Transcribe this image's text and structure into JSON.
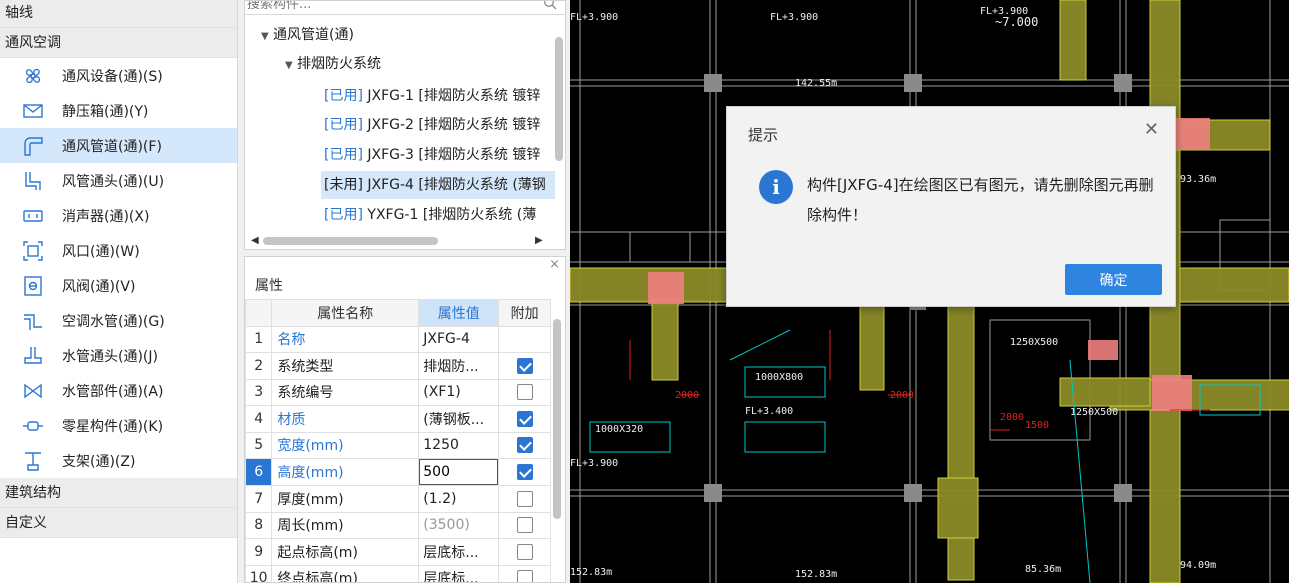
{
  "sidebar": {
    "headers": {
      "axis": "轴线",
      "hvac": "通风空调",
      "structure": "建筑结构",
      "custom": "自定义"
    },
    "items": [
      {
        "label": "通风设备(通)(S)",
        "icon": "fan-icon"
      },
      {
        "label": "静压箱(通)(Y)",
        "icon": "plenum-box-icon"
      },
      {
        "label": "通风管道(通)(F)",
        "icon": "duct-icon",
        "selected": true
      },
      {
        "label": "风管通头(通)(U)",
        "icon": "duct-fitting-icon"
      },
      {
        "label": "消声器(通)(X)",
        "icon": "silencer-icon"
      },
      {
        "label": "风口(通)(W)",
        "icon": "air-outlet-icon"
      },
      {
        "label": "风阀(通)(V)",
        "icon": "air-valve-icon"
      },
      {
        "label": "空调水管(通)(G)",
        "icon": "water-pipe-icon"
      },
      {
        "label": "水管通头(通)(J)",
        "icon": "pipe-fitting-icon"
      },
      {
        "label": "水管部件(通)(A)",
        "icon": "pipe-component-icon"
      },
      {
        "label": "零星构件(通)(K)",
        "icon": "misc-component-icon"
      },
      {
        "label": "支架(通)(Z)",
        "icon": "bracket-icon"
      }
    ]
  },
  "tree": {
    "search_placeholder": "搜索构件...",
    "root": "通风管道(通)",
    "group": "排烟防火系统",
    "items": [
      {
        "tag": "[已用]",
        "text": " JXFG-1 [排烟防火系统 镀锌"
      },
      {
        "tag": "[已用]",
        "text": " JXFG-2 [排烟防火系统 镀锌"
      },
      {
        "tag": "[已用]",
        "text": " JXFG-3 [排烟防火系统 镀锌"
      },
      {
        "tag": "[未用]",
        "text": " JXFG-4 [排烟防火系统 (薄钢"
      },
      {
        "tag": "[已用]",
        "text": " YXFG-1 [排烟防火系统 (薄"
      }
    ]
  },
  "properties": {
    "title": "属性",
    "columns": [
      "属性名称",
      "属性值",
      "附加"
    ],
    "rows": [
      {
        "num": "1",
        "name": "名称",
        "value": "JXFG-4",
        "blue": true,
        "check": null
      },
      {
        "num": "2",
        "name": "系统类型",
        "value": "排烟防...",
        "blue": false,
        "check": true
      },
      {
        "num": "3",
        "name": "系统编号",
        "value": "(XF1)",
        "blue": false,
        "check": false
      },
      {
        "num": "4",
        "name": "材质",
        "value": "(薄钢板...",
        "blue": true,
        "check": true
      },
      {
        "num": "5",
        "name": "宽度(mm)",
        "value": "1250",
        "blue": true,
        "check": true
      },
      {
        "num": "6",
        "name": "高度(mm)",
        "value": "500",
        "blue": true,
        "check": true
      },
      {
        "num": "7",
        "name": "厚度(mm)",
        "value": "(1.2)",
        "blue": false,
        "check": false
      },
      {
        "num": "8",
        "name": "周长(mm)",
        "value": "(3500)",
        "blue": false,
        "check": false
      },
      {
        "num": "9",
        "name": "起点标高(m)",
        "value": "层底标...",
        "blue": false,
        "check": false
      },
      {
        "num": "10",
        "name": "终点标高(m)",
        "value": "层底标...",
        "blue": false,
        "check": false
      }
    ]
  },
  "dialog": {
    "title": "提示",
    "message": "构件[JXFG-4]在绘图区已有图元，请先删除图元再删除构件！",
    "ok_label": "确定"
  },
  "drawing": {
    "labels": [
      "FL+3.900",
      "FL+3.900",
      "~7.000",
      "FL+3.900",
      "1000X800",
      "2000",
      "2000",
      "1250X500",
      "FL+3.400",
      "1250X500",
      "1000X320",
      "FL+3.900",
      "2000",
      "1500",
      "142.55m",
      "152.83m",
      "152.83m",
      "85.36m",
      "94.09m",
      "93.36m"
    ],
    "colors": {
      "background": "#000000",
      "duct": "#c8c84a",
      "highlight": "#f08080",
      "wall": "#9a9a9a",
      "dim": "#e02020",
      "text": "#f0f0f0",
      "cyan": "#00c8c8"
    }
  }
}
